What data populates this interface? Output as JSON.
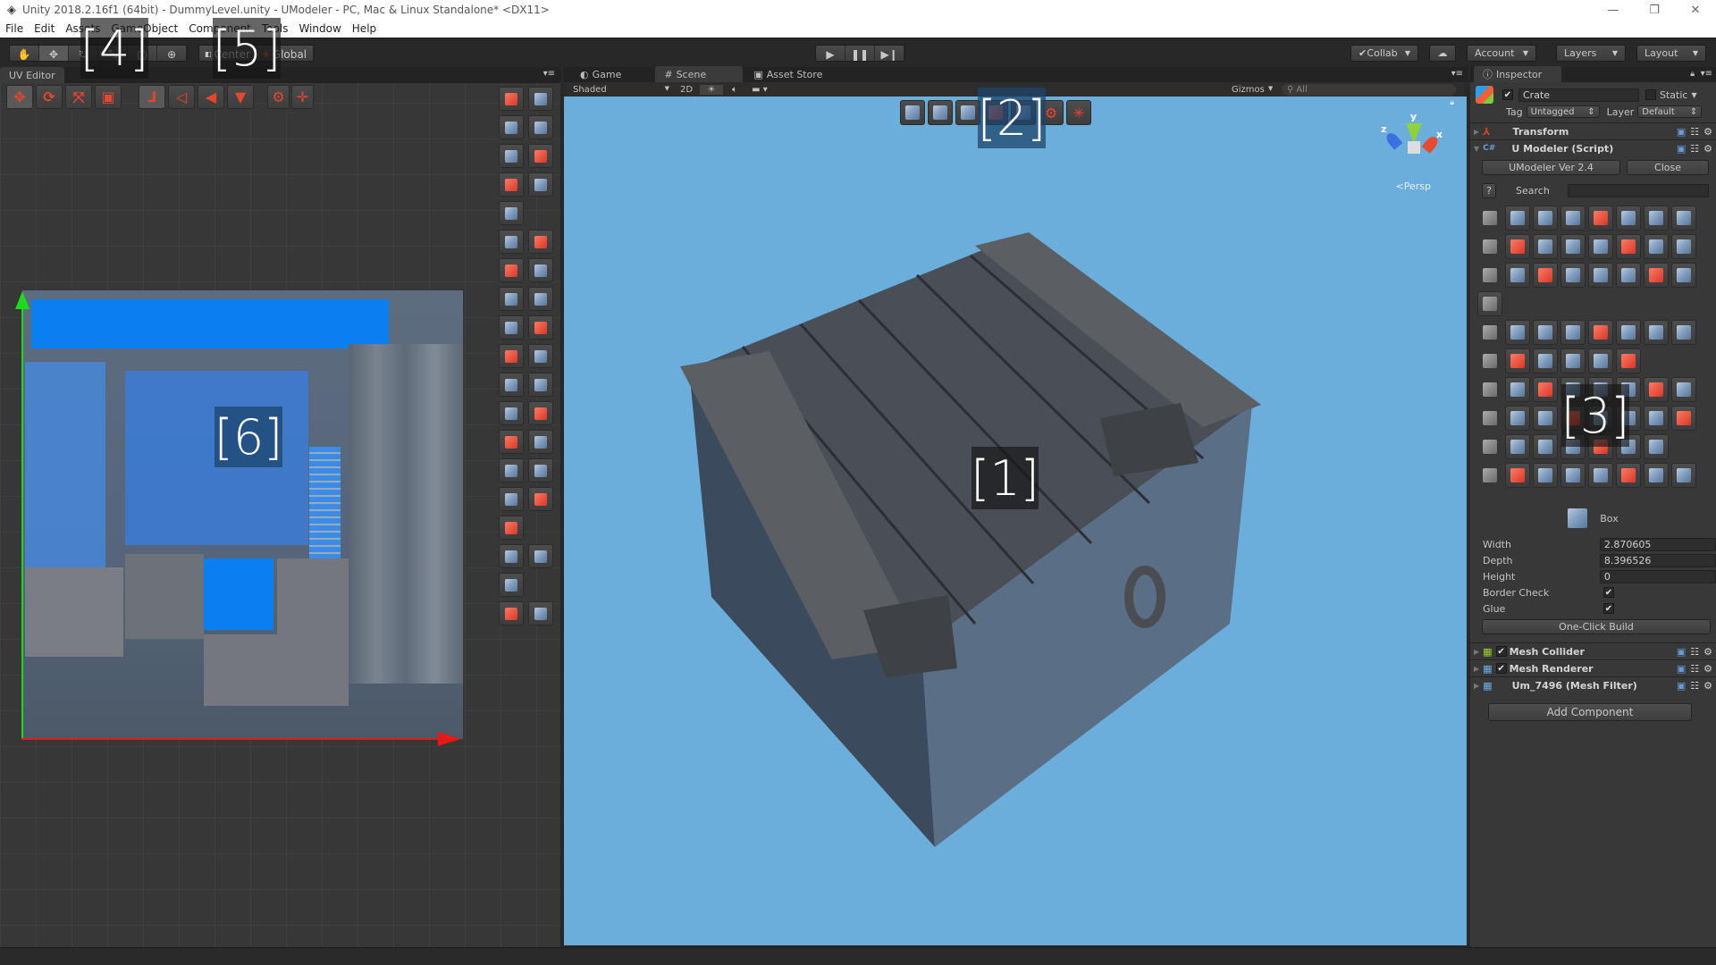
{
  "window": {
    "title": "Unity 2018.2.16f1 (64bit) - DummyLevel.unity - UModeler - PC, Mac & Linux Standalone* <DX11>",
    "controls": [
      "minimize",
      "restore",
      "close"
    ]
  },
  "menu": [
    "File",
    "Edit",
    "Assets",
    "GameObject",
    "Component",
    "Tools",
    "Window",
    "Help"
  ],
  "toolbar": {
    "transform_tools": [
      "hand-tool",
      "move-tool",
      "rotate-tool",
      "scale-tool",
      "rect-tool",
      "transform-tool"
    ],
    "active_tool": "move-tool",
    "pivot_mode": "Center",
    "pivot_rotation": "Global",
    "play_controls": [
      "play",
      "pause",
      "step"
    ],
    "collab": "Collab",
    "account": "Account",
    "layers": "Layers",
    "layout": "Layout"
  },
  "overlay_labels": {
    "l1": "[1]",
    "l2": "[2]",
    "l3": "[3]",
    "l4": "[4]",
    "l5": "[5]",
    "l6": "[6]"
  },
  "uv_editor": {
    "tab_label": "UV Editor",
    "toolbar_groups": [
      [
        "move",
        "rotate",
        "scale",
        "rect"
      ],
      [
        "vertex",
        "edge",
        "face",
        "uv-island"
      ],
      [
        "settings",
        "pivot"
      ]
    ],
    "active_buttons": [
      "move",
      "vertex"
    ],
    "side_tools_count": 36
  },
  "scene": {
    "tabs": [
      {
        "label": "Game",
        "icon": "pacman-icon",
        "active": false
      },
      {
        "label": "Scene",
        "icon": "hash-icon",
        "active": true
      },
      {
        "label": "Asset Store",
        "icon": "bag-icon",
        "active": false
      }
    ],
    "shading_mode": "Shaded",
    "mode_2d": "2D",
    "gizmos": "Gizmos",
    "search_placeholder": "All",
    "projection": "Persp",
    "axes": {
      "x": "x",
      "y": "y",
      "z": "z"
    },
    "overlay_tools": [
      "vertex-mode",
      "edge-mode",
      "polygon-mode",
      "object-mode",
      "add-object",
      "settings",
      "pivot-center"
    ]
  },
  "inspector": {
    "tab_label": "Inspector",
    "object_name": "Crate",
    "object_active": true,
    "static_label": "Static",
    "static": false,
    "tag_label": "Tag",
    "tag_value": "Untagged",
    "layer_label": "Layer",
    "layer_value": "Default",
    "components": [
      {
        "name": "Transform",
        "expanded": false,
        "has_checkbox": false
      },
      {
        "name": "U Modeler (Script)",
        "expanded": true,
        "has_checkbox": false
      }
    ],
    "umodeler": {
      "version_button": "UModeler Ver 2.4",
      "close_button": "Close",
      "help_button": "?",
      "search_label": "Search",
      "search_value": "",
      "selected_tool": "Box",
      "props": [
        {
          "label": "Width",
          "value": "2.870605"
        },
        {
          "label": "Depth",
          "value": "8.396526"
        },
        {
          "label": "Height",
          "value": "0"
        }
      ],
      "checks": [
        {
          "label": "Border Check",
          "checked": true
        },
        {
          "label": "Glue",
          "checked": true
        }
      ],
      "build_button": "One-Click Build"
    },
    "other_components": [
      {
        "name": "Mesh Collider",
        "checked": true
      },
      {
        "name": "Mesh Renderer",
        "checked": true
      },
      {
        "name": "Um_7496 (Mesh Filter)",
        "checked": null
      }
    ],
    "add_component": "Add Component"
  },
  "colors": {
    "accent_red": "#e8452f",
    "uv_selection_blue": "#0a7ff0",
    "scene_sky": "#6baedc",
    "editor_bg": "#383838"
  }
}
